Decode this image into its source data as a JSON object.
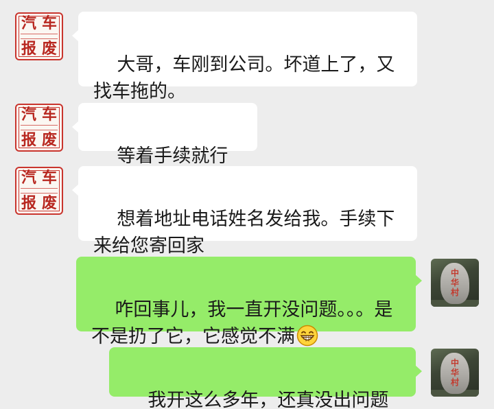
{
  "messages": [
    {
      "side": "left",
      "text": "大哥，车刚到公司。坏道上了，又找车拖的。"
    },
    {
      "side": "left",
      "text": "等着手续就行了"
    },
    {
      "side": "left",
      "text": "想着地址电话姓名发给我。手续下来给您寄回家"
    },
    {
      "side": "right",
      "text": "咋回事儿，我一直开没问题。。。是不是扔了它，它感觉不满",
      "emoji": "grin-icon"
    },
    {
      "side": "right",
      "text": "我开这么多年，还真没出问题"
    }
  ],
  "contact_avatar": {
    "logo_chars": [
      "汽",
      "车",
      "报",
      "废"
    ],
    "accent": "#c9342d"
  },
  "self_avatar": {
    "stone_text": "中华村"
  },
  "colors": {
    "background": "#ededed",
    "incoming_bubble": "#ffffff",
    "outgoing_bubble": "#95ec69"
  }
}
